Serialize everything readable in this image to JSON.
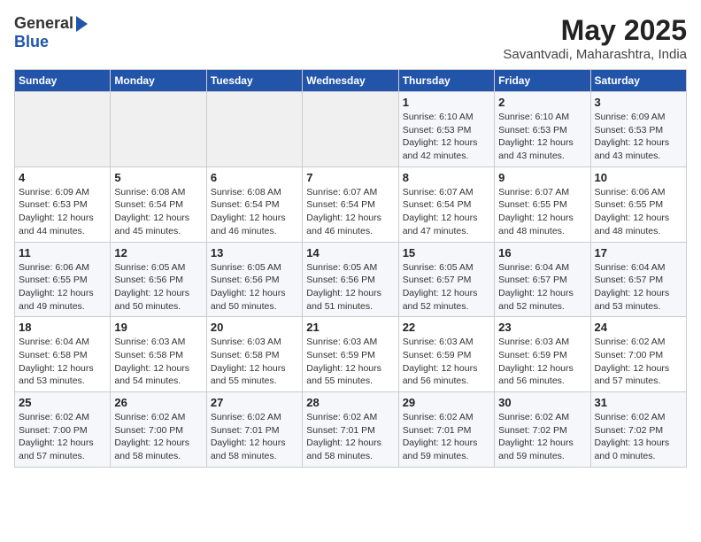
{
  "header": {
    "logo_general": "General",
    "logo_blue": "Blue",
    "month_title": "May 2025",
    "subtitle": "Savantvadi, Maharashtra, India"
  },
  "weekdays": [
    "Sunday",
    "Monday",
    "Tuesday",
    "Wednesday",
    "Thursday",
    "Friday",
    "Saturday"
  ],
  "weeks": [
    [
      {
        "day": "",
        "info": ""
      },
      {
        "day": "",
        "info": ""
      },
      {
        "day": "",
        "info": ""
      },
      {
        "day": "",
        "info": ""
      },
      {
        "day": "1",
        "info": "Sunrise: 6:10 AM\nSunset: 6:53 PM\nDaylight: 12 hours\nand 42 minutes."
      },
      {
        "day": "2",
        "info": "Sunrise: 6:10 AM\nSunset: 6:53 PM\nDaylight: 12 hours\nand 43 minutes."
      },
      {
        "day": "3",
        "info": "Sunrise: 6:09 AM\nSunset: 6:53 PM\nDaylight: 12 hours\nand 43 minutes."
      }
    ],
    [
      {
        "day": "4",
        "info": "Sunrise: 6:09 AM\nSunset: 6:53 PM\nDaylight: 12 hours\nand 44 minutes."
      },
      {
        "day": "5",
        "info": "Sunrise: 6:08 AM\nSunset: 6:54 PM\nDaylight: 12 hours\nand 45 minutes."
      },
      {
        "day": "6",
        "info": "Sunrise: 6:08 AM\nSunset: 6:54 PM\nDaylight: 12 hours\nand 46 minutes."
      },
      {
        "day": "7",
        "info": "Sunrise: 6:07 AM\nSunset: 6:54 PM\nDaylight: 12 hours\nand 46 minutes."
      },
      {
        "day": "8",
        "info": "Sunrise: 6:07 AM\nSunset: 6:54 PM\nDaylight: 12 hours\nand 47 minutes."
      },
      {
        "day": "9",
        "info": "Sunrise: 6:07 AM\nSunset: 6:55 PM\nDaylight: 12 hours\nand 48 minutes."
      },
      {
        "day": "10",
        "info": "Sunrise: 6:06 AM\nSunset: 6:55 PM\nDaylight: 12 hours\nand 48 minutes."
      }
    ],
    [
      {
        "day": "11",
        "info": "Sunrise: 6:06 AM\nSunset: 6:55 PM\nDaylight: 12 hours\nand 49 minutes."
      },
      {
        "day": "12",
        "info": "Sunrise: 6:05 AM\nSunset: 6:56 PM\nDaylight: 12 hours\nand 50 minutes."
      },
      {
        "day": "13",
        "info": "Sunrise: 6:05 AM\nSunset: 6:56 PM\nDaylight: 12 hours\nand 50 minutes."
      },
      {
        "day": "14",
        "info": "Sunrise: 6:05 AM\nSunset: 6:56 PM\nDaylight: 12 hours\nand 51 minutes."
      },
      {
        "day": "15",
        "info": "Sunrise: 6:05 AM\nSunset: 6:57 PM\nDaylight: 12 hours\nand 52 minutes."
      },
      {
        "day": "16",
        "info": "Sunrise: 6:04 AM\nSunset: 6:57 PM\nDaylight: 12 hours\nand 52 minutes."
      },
      {
        "day": "17",
        "info": "Sunrise: 6:04 AM\nSunset: 6:57 PM\nDaylight: 12 hours\nand 53 minutes."
      }
    ],
    [
      {
        "day": "18",
        "info": "Sunrise: 6:04 AM\nSunset: 6:58 PM\nDaylight: 12 hours\nand 53 minutes."
      },
      {
        "day": "19",
        "info": "Sunrise: 6:03 AM\nSunset: 6:58 PM\nDaylight: 12 hours\nand 54 minutes."
      },
      {
        "day": "20",
        "info": "Sunrise: 6:03 AM\nSunset: 6:58 PM\nDaylight: 12 hours\nand 55 minutes."
      },
      {
        "day": "21",
        "info": "Sunrise: 6:03 AM\nSunset: 6:59 PM\nDaylight: 12 hours\nand 55 minutes."
      },
      {
        "day": "22",
        "info": "Sunrise: 6:03 AM\nSunset: 6:59 PM\nDaylight: 12 hours\nand 56 minutes."
      },
      {
        "day": "23",
        "info": "Sunrise: 6:03 AM\nSunset: 6:59 PM\nDaylight: 12 hours\nand 56 minutes."
      },
      {
        "day": "24",
        "info": "Sunrise: 6:02 AM\nSunset: 7:00 PM\nDaylight: 12 hours\nand 57 minutes."
      }
    ],
    [
      {
        "day": "25",
        "info": "Sunrise: 6:02 AM\nSunset: 7:00 PM\nDaylight: 12 hours\nand 57 minutes."
      },
      {
        "day": "26",
        "info": "Sunrise: 6:02 AM\nSunset: 7:00 PM\nDaylight: 12 hours\nand 58 minutes."
      },
      {
        "day": "27",
        "info": "Sunrise: 6:02 AM\nSunset: 7:01 PM\nDaylight: 12 hours\nand 58 minutes."
      },
      {
        "day": "28",
        "info": "Sunrise: 6:02 AM\nSunset: 7:01 PM\nDaylight: 12 hours\nand 58 minutes."
      },
      {
        "day": "29",
        "info": "Sunrise: 6:02 AM\nSunset: 7:01 PM\nDaylight: 12 hours\nand 59 minutes."
      },
      {
        "day": "30",
        "info": "Sunrise: 6:02 AM\nSunset: 7:02 PM\nDaylight: 12 hours\nand 59 minutes."
      },
      {
        "day": "31",
        "info": "Sunrise: 6:02 AM\nSunset: 7:02 PM\nDaylight: 13 hours\nand 0 minutes."
      }
    ]
  ]
}
